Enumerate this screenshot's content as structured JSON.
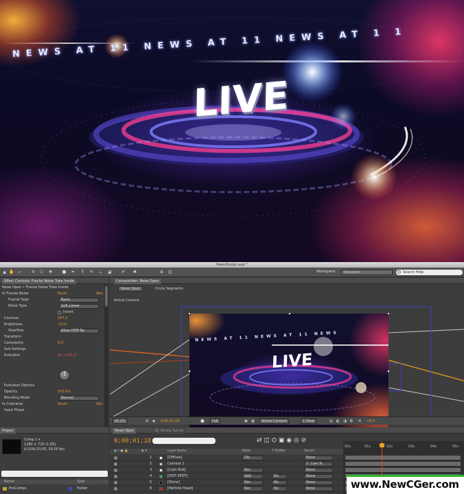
{
  "hero": {
    "ticker_text": "NEWS AT 11 NEWS AT 11 NEWS AT 1 1",
    "live_text": "LIVE"
  },
  "window": {
    "title": "NewsDesign.aep *"
  },
  "toolbar": {
    "workspace_label": "Workspace",
    "workspace_value": "Standard",
    "search_placeholder": "Search Help"
  },
  "effect_controls": {
    "tab": "Effect Controls: Fractal Noise Tube Inside",
    "breadcrumb": "News Open • Fractal Noise Tube Inside",
    "rows": [
      {
        "label": "fx Fractal Noise",
        "reset": "Reset",
        "about": "Abo"
      },
      {
        "label": "Fractal Type",
        "dropdown": "Basic"
      },
      {
        "label": "Noise Type",
        "dropdown": "Soft Linear"
      },
      {
        "label": "",
        "checkbox_label": "Invert"
      },
      {
        "label": "Contrast",
        "value": "167.0"
      },
      {
        "label": "Brightness",
        "value": "-13.0"
      },
      {
        "label": "Overflow",
        "dropdown": "Allow HDR Re"
      },
      {
        "label": "Transform"
      },
      {
        "label": "Complexity",
        "value": "6.0"
      },
      {
        "label": "Sub Settings"
      },
      {
        "label": "Evolution",
        "value": "0x +260.2°"
      },
      {
        "label": "Evolution Options"
      },
      {
        "label": "Opacity",
        "value": "100.0%"
      },
      {
        "label": "Blending Mode",
        "dropdown": "Normal"
      },
      {
        "label": "fx Colorama",
        "reset": "Reset",
        "about": "Abo"
      },
      {
        "label": "Input Phase"
      }
    ]
  },
  "composition": {
    "tab": "Composition: News Open",
    "comp_button": "News Open",
    "breadcrumb_item": "Circle Segments",
    "view_label": "Active Camera",
    "viewer_live_text": "LIVE",
    "viewer_ticker": "NEWS AT 11 NEWS AT 11 NEWS",
    "zoom": "42.2%",
    "timecode": "0;00;01;18",
    "resolution": "Full",
    "camera": "Active Camera",
    "views": "1 View",
    "exposure": "+0.0"
  },
  "project": {
    "tab": "Project",
    "comp_name": "Comp 1 ▾",
    "comp_size": "1280 × 720 (1.00)",
    "comp_duration": "Δ 0;00;10;00, 30.00 fps",
    "col_name": "Name",
    "col_type": "Type",
    "item_name": "PreComps",
    "item_type": "Folder"
  },
  "timeline": {
    "tabs": [
      "News Open",
      "3D Stroke Tunnel"
    ],
    "timecode": "0;00;01;18",
    "columns": {
      "layer_name": "Layer Name",
      "mode": "Mode",
      "trkmat": "T TrkMat",
      "parent": "Parent"
    },
    "ruler_ticks": [
      "00s",
      "01s",
      "02s",
      "03s",
      "04s",
      "05s"
    ],
    "layers": [
      {
        "num": "1",
        "name": "[Diffuse]",
        "mode": "Div",
        "trkmat": "",
        "parent": "None",
        "swatch": "#ffffff"
      },
      {
        "num": "2",
        "name": "Camera 1",
        "mode": "",
        "trkmat": "",
        "parent": "7. Cam N",
        "swatch": "#cccccc"
      },
      {
        "num": "3",
        "name": "[Cam Null]",
        "mode": "Nor",
        "trkmat": "",
        "parent": "None",
        "swatch": "#ffffff"
      },
      {
        "num": "4",
        "name": "[HOT SPOT]",
        "mode": "Add",
        "trkmat": "No",
        "parent": "None",
        "swatch": "#39b54a"
      },
      {
        "num": "5",
        "name": "[Shine]",
        "mode": "Nor",
        "trkmat": "No",
        "parent": "None",
        "swatch": "#111111"
      },
      {
        "num": "6",
        "name": "[Particle Head]",
        "mode": "Nor",
        "trkmat": "No",
        "parent": "None",
        "swatch": "#d62020"
      }
    ]
  },
  "watermark": {
    "text": "www.NewCGer.com"
  },
  "colors": {
    "accent_orange": "#e29a2b",
    "playhead": "#e7461f",
    "watermark_bar": "#2ab32a"
  }
}
